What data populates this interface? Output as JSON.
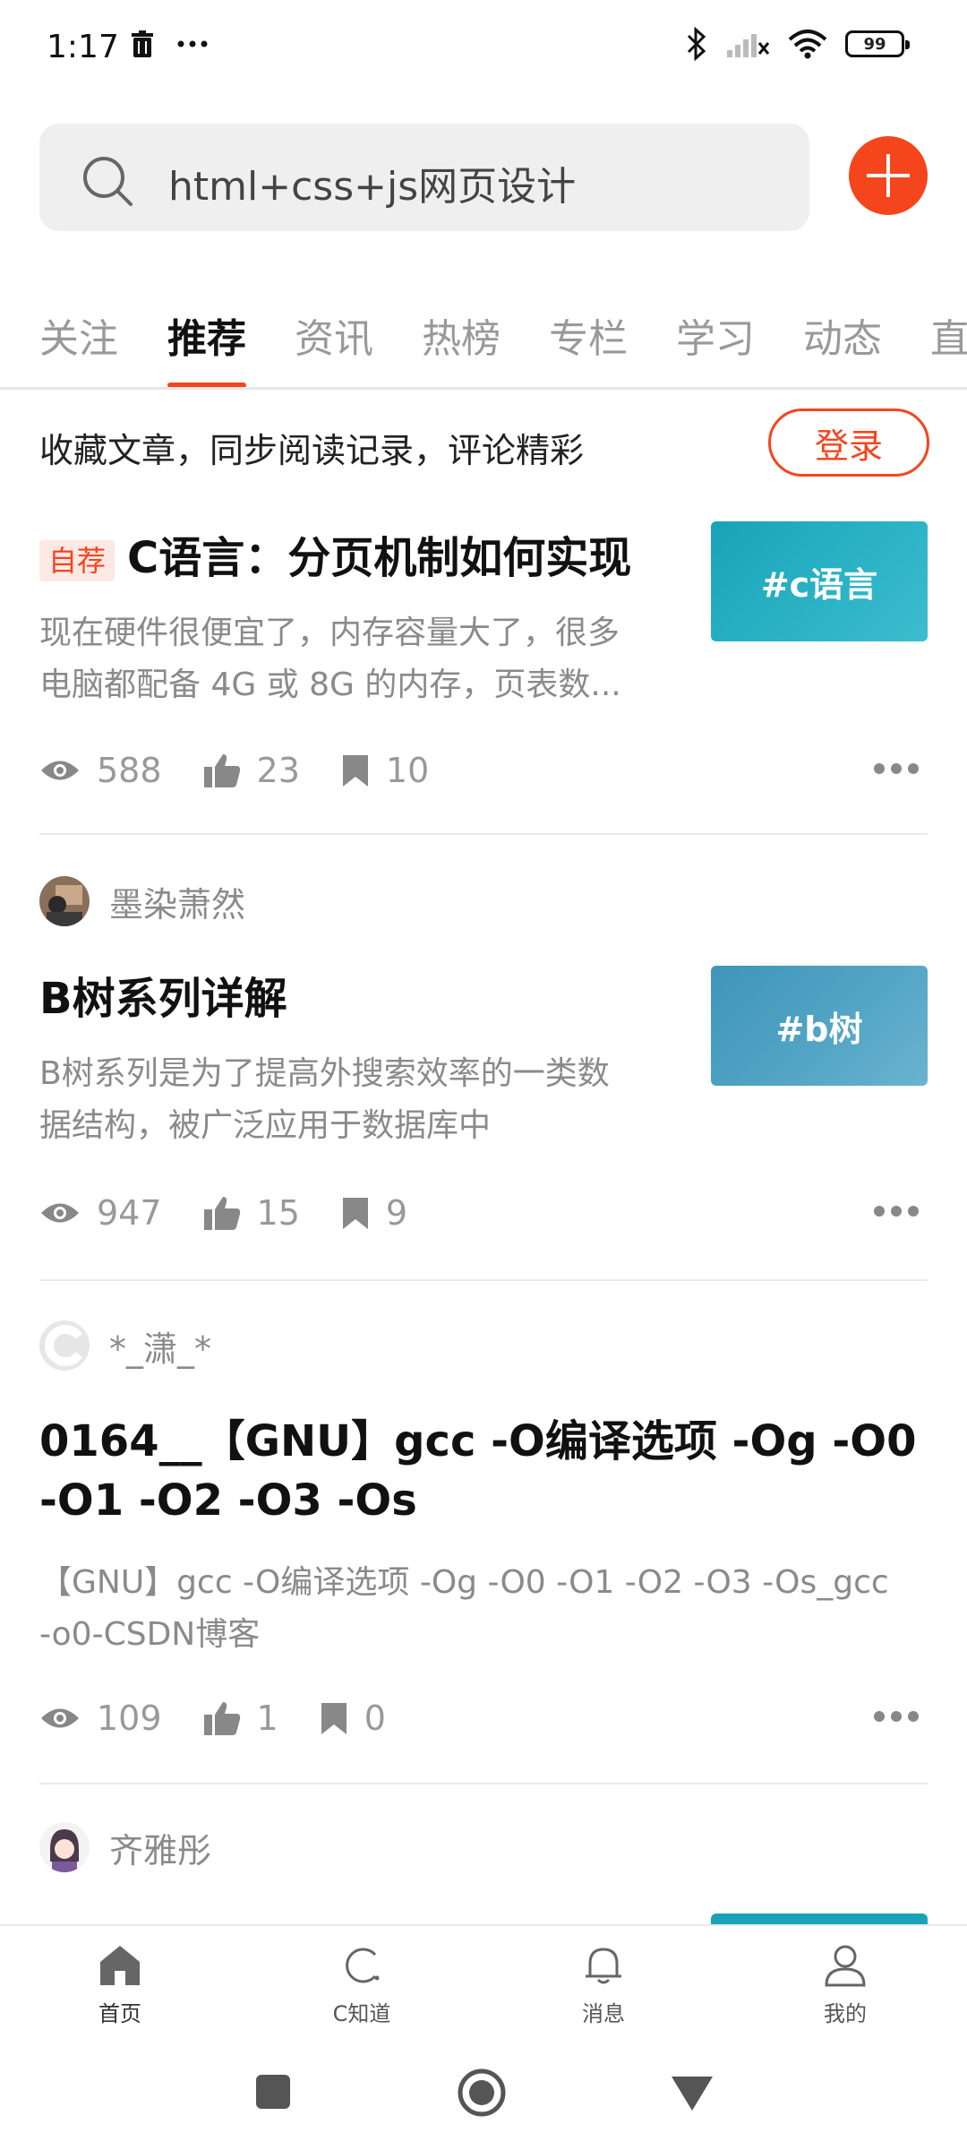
{
  "status_bar": {
    "time": "1:17",
    "battery": "99",
    "icons": [
      "trash-icon",
      "more-dots-icon",
      "bluetooth-icon",
      "signal-icon",
      "wifi-icon",
      "battery-icon"
    ]
  },
  "search": {
    "query": "html+css+js网页设计",
    "icon": "search-icon"
  },
  "add_button": {
    "icon": "plus-icon",
    "color": "#f5451d"
  },
  "tabs": {
    "items": [
      "关注",
      "推荐",
      "资讯",
      "热榜",
      "专栏",
      "学习",
      "动态",
      "直"
    ],
    "active_index": 1
  },
  "login_prompt": {
    "text": "收藏文章，同步阅读记录，评论精彩",
    "button": "登录"
  },
  "articles": [
    {
      "badge": "自荐",
      "title": "C语言：分页机制如何实现",
      "summary_line1": "现在硬件很便宜了，内存容量大了，很多",
      "summary_line2": "电脑都配备 4G 或 8G 的内存，页表数...",
      "thumb": "#c语言",
      "views": "588",
      "likes": "23",
      "favorites": "10"
    },
    {
      "author": "墨染萧然",
      "title": "B树系列详解",
      "summary_line1": "B树系列是为了提高外搜索效率的一类数",
      "summary_line2": "据结构，被广泛应用于数据库中",
      "thumb": "#b树",
      "views": "947",
      "likes": "15",
      "favorites": "9"
    },
    {
      "author": "*_潇_*",
      "title_line1": "0164__【GNU】gcc -O编译选项 -Og -O0",
      "title_line2": "-O1 -O2 -O3 -Os",
      "summary_line1": "【GNU】gcc -O编译选项 -Og -O0 -O1 -O2 -O3 -Os_gcc",
      "summary_line2": "-o0-CSDN博客",
      "views": "109",
      "likes": "1",
      "favorites": "0"
    },
    {
      "author": "齐雅彤"
    }
  ],
  "bottom_nav": {
    "items": [
      {
        "label": "首页",
        "icon": "home-icon"
      },
      {
        "label": "C知道",
        "icon": "c-know-icon"
      },
      {
        "label": "消息",
        "icon": "bell-icon"
      },
      {
        "label": "我的",
        "icon": "profile-icon"
      }
    ],
    "active_index": 0
  },
  "system_nav": [
    "recent-apps-icon",
    "home-circle-icon",
    "back-triangle-icon"
  ]
}
